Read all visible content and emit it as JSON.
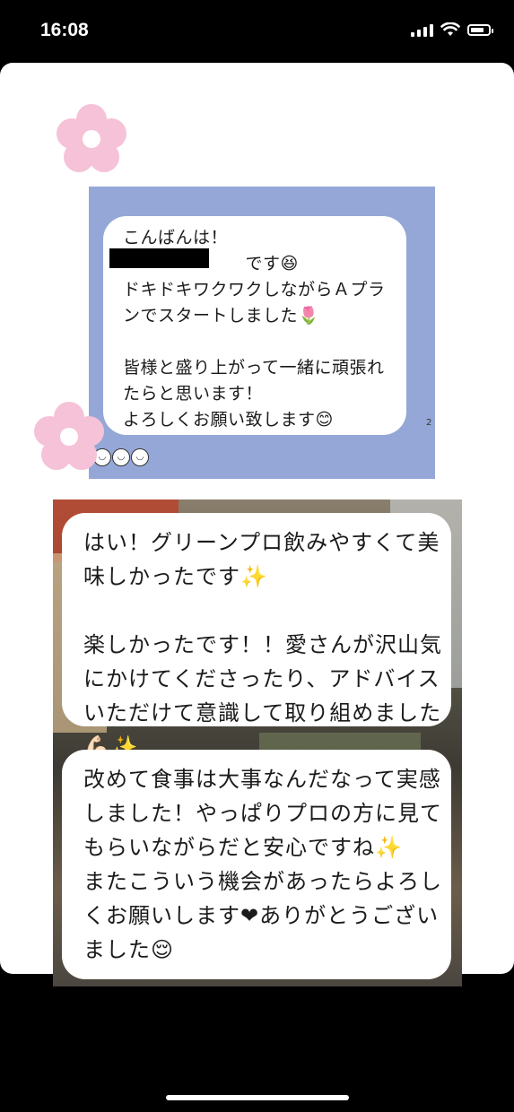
{
  "status_bar": {
    "time": "16:08",
    "signal_icon": "cellular-signal-icon",
    "wifi_icon": "wifi-icon",
    "battery_icon": "battery-icon",
    "battery_level": 0.75
  },
  "message_1": {
    "text": "こんばんは！\n　　　　　　　です😆\nドキドキワクワクしながらＡプランでスタートしました🌷\n\n皆様と盛り上がって一緒に頑張れたらと思います！\nよろしくお願い致します😊",
    "read_count": "2",
    "reaction": "😀😀😀"
  },
  "message_2": {
    "text": "はい！グリーンプロ飲みやすくて美味しかったです✨\n\n楽しかったです！！愛さんが沢山気にかけてくださったり、アドバイスいただけて意識して取り組めました💪🏻✨"
  },
  "message_3": {
    "text": "改めて食事は大事なんだなって実感しました！やっぱりプロの方に見てもらいながらだと安心ですね✨\nまたこういう機会があったらよろしくお願いします❤ありがとうございました😌"
  },
  "colors": {
    "panel_blue": "#94a7d7",
    "flower_pink": "#f5c2d7",
    "card": "#ffffff",
    "background": "#000000"
  }
}
